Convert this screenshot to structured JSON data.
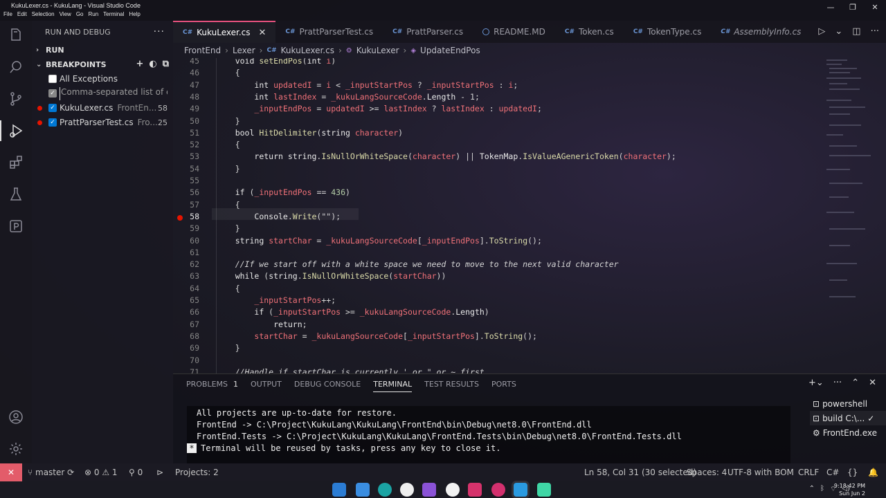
{
  "window": {
    "title": "KukuLexer.cs - KukuLang - Visual Studio Code",
    "menu": [
      "File",
      "Edit",
      "Selection",
      "View",
      "Go",
      "Run",
      "Terminal",
      "Help"
    ]
  },
  "sidebar": {
    "header": "RUN AND DEBUG",
    "run_section": "RUN",
    "breakpoints_section": "BREAKPOINTS",
    "items": [
      {
        "label": "All Exceptions",
        "path": "",
        "line": "",
        "checked": false
      },
      {
        "label": "",
        "placeholder": "Comma-separated list of exc",
        "path": "",
        "line": "",
        "checked": true
      },
      {
        "label": "KukuLexer.cs",
        "path": "FrontEn...",
        "line": "58",
        "checked": true
      },
      {
        "label": "PrattParserTest.cs",
        "path": "Fro...",
        "line": "25",
        "checked": true
      }
    ]
  },
  "tabs": [
    {
      "label": "KukuLexer.cs",
      "active": true,
      "icon": "csharp-icon"
    },
    {
      "label": "PrattParserTest.cs",
      "active": false,
      "icon": "csharp-icon"
    },
    {
      "label": "PrattParser.cs",
      "active": false,
      "icon": "csharp-icon"
    },
    {
      "label": "README.MD",
      "active": false,
      "icon": "info-icon"
    },
    {
      "label": "Token.cs",
      "active": false,
      "icon": "csharp-icon"
    },
    {
      "label": "TokenType.cs",
      "active": false,
      "icon": "csharp-icon"
    },
    {
      "label": "AssemblyInfo.cs",
      "active": false,
      "icon": "csharp-icon"
    }
  ],
  "breadcrumb": [
    "FrontEnd",
    "Lexer",
    "KukuLexer.cs",
    "KukuLexer",
    "UpdateEndPos"
  ],
  "editor": {
    "current_line": 58,
    "breakpoint_line": 58,
    "lines": [
      {
        "n": "45",
        "code": "    void setEndPos(int i)"
      },
      {
        "n": "46",
        "code": "    {"
      },
      {
        "n": "47",
        "code": "        int updatedI = i < _inputStartPos ? _inputStartPos : i;"
      },
      {
        "n": "48",
        "code": "        int lastIndex = _kukuLangSourceCode.Length - 1;"
      },
      {
        "n": "49",
        "code": "        _inputEndPos = updatedI >= lastIndex ? lastIndex : updatedI;"
      },
      {
        "n": "50",
        "code": "    }"
      },
      {
        "n": "51",
        "code": "    bool HitDelimiter(string character)"
      },
      {
        "n": "52",
        "code": "    {"
      },
      {
        "n": "53",
        "code": "        return string.IsNullOrWhiteSpace(character) || TokenMap.IsValueAGenericToken(character);"
      },
      {
        "n": "54",
        "code": "    }"
      },
      {
        "n": "55",
        "code": ""
      },
      {
        "n": "56",
        "code": "    if (_inputEndPos == 436)"
      },
      {
        "n": "57",
        "code": "    {"
      },
      {
        "n": "58",
        "code": "        Console.Write(\"\");"
      },
      {
        "n": "59",
        "code": "    }"
      },
      {
        "n": "60",
        "code": "    string startChar = _kukuLangSourceCode[_inputEndPos].ToString();"
      },
      {
        "n": "61",
        "code": ""
      },
      {
        "n": "62",
        "code": "    //If we start off with a white space we need to move to the next valid character"
      },
      {
        "n": "63",
        "code": "    while (string.IsNullOrWhiteSpace(startChar))"
      },
      {
        "n": "64",
        "code": "    {"
      },
      {
        "n": "65",
        "code": "        _inputStartPos++;"
      },
      {
        "n": "66",
        "code": "        if (_inputStartPos >= _kukuLangSourceCode.Length)"
      },
      {
        "n": "67",
        "code": "            return;"
      },
      {
        "n": "68",
        "code": "        startChar = _kukuLangSourceCode[_inputStartPos].ToString();"
      },
      {
        "n": "69",
        "code": "    }"
      },
      {
        "n": "70",
        "code": ""
      },
      {
        "n": "71",
        "code": "    //Handle if startChar is currently ' or \" or ~ first"
      }
    ]
  },
  "panel": {
    "tabs": [
      "PROBLEMS",
      "OUTPUT",
      "DEBUG CONSOLE",
      "TERMINAL",
      "TEST RESULTS",
      "PORTS"
    ],
    "problems_count": "1",
    "active_tab": "TERMINAL",
    "terminal_lines": [
      "All projects are up-to-date for restore.",
      "FrontEnd -> C:\\Project\\KukuLang\\KukuLang\\FrontEnd\\bin\\Debug\\net8.0\\FrontEnd.dll",
      "FrontEnd.Tests -> C:\\Project\\KukuLang\\KukuLang\\FrontEnd.Tests\\bin\\Debug\\net8.0\\FrontEnd.Tests.dll",
      "Terminal will be reused by tasks, press any key to close it."
    ],
    "terminal_star": "*",
    "terminals": [
      "powershell",
      "build C:\\...",
      "FrontEnd.exe"
    ]
  },
  "statusbar": {
    "branch": "master",
    "errors": "0",
    "warnings": "1",
    "ports": "0",
    "projects": "Projects: 2",
    "position": "Ln 58, Col 31 (30 selected)",
    "spaces": "Spaces: 4",
    "encoding": "UTF-8 with BOM",
    "eol": "CRLF",
    "language": "C#"
  },
  "taskbar": {
    "time": "9:18:42 PM",
    "date": "Sun Jun 2"
  },
  "colors": {
    "accent_tab": "#e5517d",
    "breakpoint": "#e51400",
    "remote": "#e35c6a"
  }
}
